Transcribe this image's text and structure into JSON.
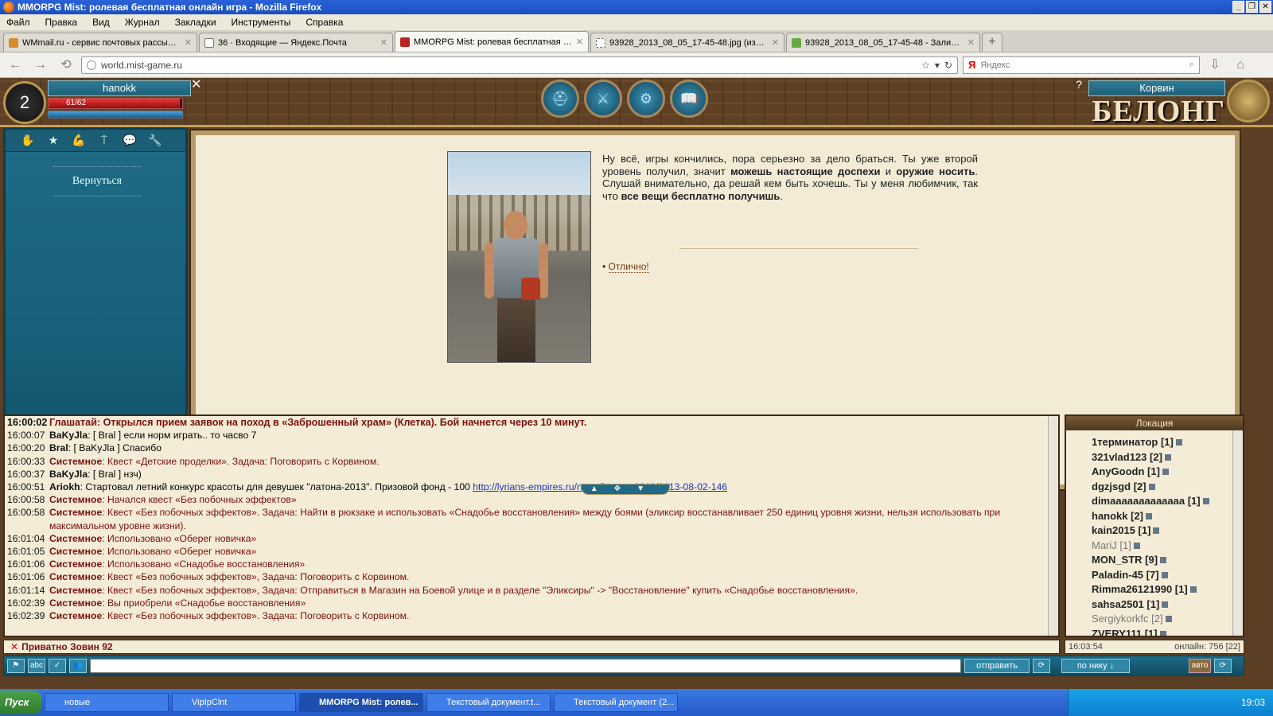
{
  "window": {
    "title": "MMORPG Mist: ролевая бесплатная онлайн игра - Mozilla Firefox"
  },
  "menu": [
    "Файл",
    "Правка",
    "Вид",
    "Журнал",
    "Закладки",
    "Инструменты",
    "Справка"
  ],
  "tabs": [
    {
      "label": "WMmail.ru - сервис почтовых рассылок..."
    },
    {
      "label": "36 · Входящие — Яндекс.Почта"
    },
    {
      "label": "MMORPG Mist: ролевая бесплатная онл..."
    },
    {
      "label": "93928_2013_08_05_17-45-48.jpg (изоб..."
    },
    {
      "label": "93928_2013_08_05_17-45-48 - Заливка..."
    }
  ],
  "url": "world.mist-game.ru",
  "search": {
    "placeholder": "Яндекс"
  },
  "player": {
    "level": "2",
    "name": "hanokk",
    "hp_text": "61/62",
    "hp_fraction": 0.98,
    "mp_fraction": 1.0
  },
  "npc": {
    "name": "Корвин",
    "logo": "БЕЛОНГ"
  },
  "left_panel": {
    "return_label": "Вернуться"
  },
  "dialog": {
    "p1": "Ну всё, игры кончились, пора серьезно за дело браться. Ты уже второй уровень получил, значит ",
    "b1": "можешь настоящие доспехи",
    "p2": " и ",
    "b2": "оружие носить",
    "p3": ". Слушай внимательно, да решай кем быть хочешь. Ты у меня любимчик, так что ",
    "b3": "все вещи бесплатно получишь",
    "p4": ".",
    "answer": "Отлично!"
  },
  "chat": [
    {
      "time": "16:00:02",
      "herald": "Глашатай: Открылся прием заявок на поход в «Заброшенный храм» (Клетка). Бой начнется через 10 минут."
    },
    {
      "time": "16:00:07",
      "nick": "BaKyJla",
      "text": ": [ Bral ] если норм играть.. то часво 7"
    },
    {
      "time": "16:00:20",
      "nick": "Bral",
      "text": ": [ BaKyJla ] Спасибо"
    },
    {
      "time": "16:00:33",
      "sys": "Системное",
      "text": ": Квест «Детские проделки». Задача: Поговорить с Корвином."
    },
    {
      "time": "16:00:37",
      "nick": "BaKyJla",
      "text": ": [ Bral ] нзч)"
    },
    {
      "time": "16:00:51",
      "nick": "Ariokh",
      "text": ":      Стартовал летний конкурс красоты для девушек \"латона-2013\".      Призовой фонд - 100 ",
      "link": "http://lyrians-empires.ru/news/latona_2013/2013-08-02-146"
    },
    {
      "time": "16:00:58",
      "sys": "Системное",
      "text": ": Начался квест «Без побочных эффектов»"
    },
    {
      "time": "16:00:58",
      "sys": "Системное",
      "text": ": Квест «Без побочных эффектов». Задача: Найти в рюкзаке и использовать «Снадобье восстановления» между боями (эликсир восстанавливает 250 единиц уровня жизни, нельзя использовать при максимальном уровне жизни)."
    },
    {
      "time": "16:01:04",
      "sys": "Системное",
      "text": ": Использовано «Оберег новичка»"
    },
    {
      "time": "16:01:05",
      "sys": "Системное",
      "text": ": Использовано «Оберег новичка»"
    },
    {
      "time": "16:01:06",
      "sys": "Системное",
      "text": ": Использовано «Снадобье восстановления»"
    },
    {
      "time": "16:01:06",
      "sys": "Системное",
      "text": ": Квест «Без побочных эффектов», Задача: Поговорить с Корвином."
    },
    {
      "time": "16:01:14",
      "sys": "Системное",
      "text": ": Квест «Без побочных эффектов», Задача: Отправиться в Магазин на Боевой улице и в разделе \"Эликсиры\" -> \"Восстановление\" купить «Снадобье восстановления»."
    },
    {
      "time": "16:02:39",
      "sys": "Системное",
      "text": ": Вы приобрели «Снадобье восстановления»"
    },
    {
      "time": "16:02:39",
      "sys": "Системное",
      "text": ": Квест «Без побочных эффектов». Задача: Поговорить с Корвином."
    }
  ],
  "location": {
    "title": "Локация",
    "players": [
      {
        "name": "1терминатор [1]"
      },
      {
        "name": "321vlad123 [2]"
      },
      {
        "name": "AnyGoodn [1]"
      },
      {
        "name": "dgzjsgd [2]"
      },
      {
        "name": "dimaaaaaaaaaaaaa [1]"
      },
      {
        "name": "hanokk [2]"
      },
      {
        "name": "kain2015 [1]"
      },
      {
        "name": "MariJ [1]",
        "faded": true
      },
      {
        "name": "MON_STR [9]"
      },
      {
        "name": "Paladin-45 [7]"
      },
      {
        "name": "Rimma26121990 [1]"
      },
      {
        "name": "sahsa2501 [1]"
      },
      {
        "name": "Sergiykorkfc [2]",
        "faded": true
      },
      {
        "name": "ZVERY111 [1]"
      }
    ]
  },
  "status": {
    "private": "Приватно Зовин 92",
    "time": "16:03:54",
    "online": "онлайн: 756 [22]"
  },
  "input": {
    "send": "отправить",
    "by_nick": "по нику ↓",
    "auto": "авто"
  },
  "taskbar": {
    "start": "Пуск",
    "items": [
      {
        "label": "новые"
      },
      {
        "label": "VipIpClnt"
      },
      {
        "label": "MMORPG Mist: ролев..."
      },
      {
        "label": "Текстовый документ.t..."
      },
      {
        "label": "Текстовый документ (2..."
      }
    ],
    "clock": "19:03"
  }
}
